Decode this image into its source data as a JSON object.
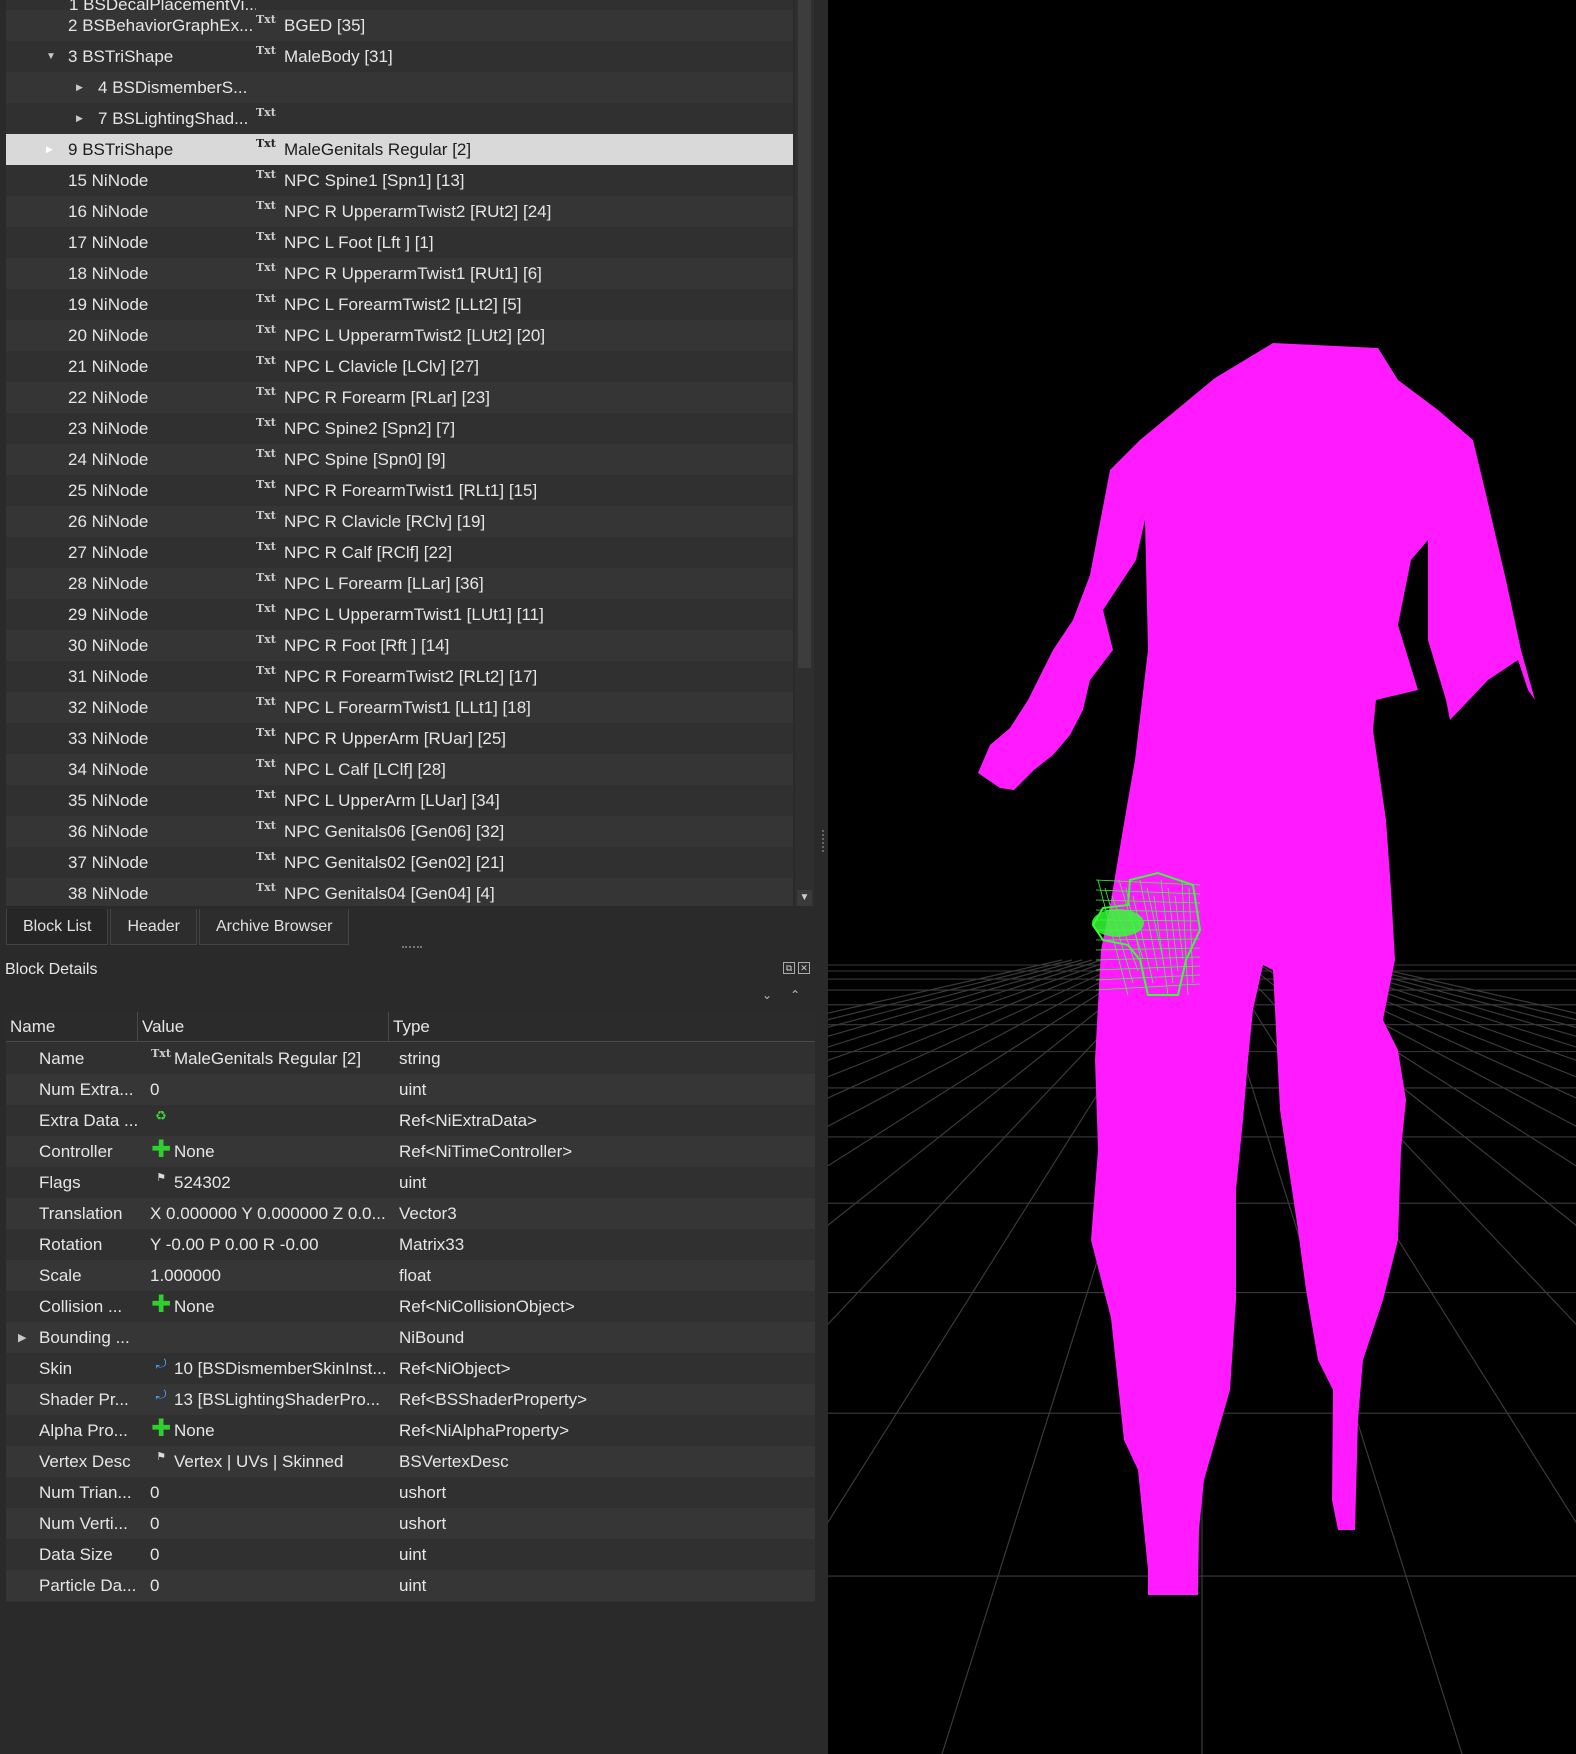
{
  "tree": {
    "partial_top": "1 BSDecalPlacementVi...",
    "rows": [
      {
        "num": "2",
        "type": "BSBehaviorGraphEx...",
        "value": "BGED [35]",
        "icon": true,
        "indent": 0,
        "arrow": ""
      },
      {
        "num": "3",
        "type": "BSTriShape",
        "value": "MaleBody [31]",
        "icon": true,
        "indent": 0,
        "arrow": "down"
      },
      {
        "num": "4",
        "type": "BSDismemberS...",
        "value": "",
        "icon": false,
        "indent": 1,
        "arrow": "right"
      },
      {
        "num": "7",
        "type": "BSLightingShad...",
        "value": "",
        "icon": true,
        "indent": 1,
        "arrow": "right"
      },
      {
        "num": "9",
        "type": "BSTriShape",
        "value": "MaleGenitals Regular [2]",
        "icon": true,
        "indent": 0,
        "arrow": "right",
        "selected": true
      },
      {
        "num": "15",
        "type": "NiNode",
        "value": "NPC Spine1 [Spn1] [13]",
        "icon": true,
        "indent": 0,
        "arrow": ""
      },
      {
        "num": "16",
        "type": "NiNode",
        "value": "NPC R UpperarmTwist2 [RUt2] [24]",
        "icon": true,
        "indent": 0,
        "arrow": ""
      },
      {
        "num": "17",
        "type": "NiNode",
        "value": "NPC L Foot [Lft ] [1]",
        "icon": true,
        "indent": 0,
        "arrow": ""
      },
      {
        "num": "18",
        "type": "NiNode",
        "value": "NPC R UpperarmTwist1 [RUt1] [6]",
        "icon": true,
        "indent": 0,
        "arrow": ""
      },
      {
        "num": "19",
        "type": "NiNode",
        "value": "NPC L ForearmTwist2 [LLt2] [5]",
        "icon": true,
        "indent": 0,
        "arrow": ""
      },
      {
        "num": "20",
        "type": "NiNode",
        "value": "NPC L UpperarmTwist2 [LUt2] [20]",
        "icon": true,
        "indent": 0,
        "arrow": ""
      },
      {
        "num": "21",
        "type": "NiNode",
        "value": "NPC L Clavicle [LClv] [27]",
        "icon": true,
        "indent": 0,
        "arrow": ""
      },
      {
        "num": "22",
        "type": "NiNode",
        "value": "NPC R Forearm [RLar] [23]",
        "icon": true,
        "indent": 0,
        "arrow": ""
      },
      {
        "num": "23",
        "type": "NiNode",
        "value": "NPC Spine2 [Spn2] [7]",
        "icon": true,
        "indent": 0,
        "arrow": ""
      },
      {
        "num": "24",
        "type": "NiNode",
        "value": "NPC Spine [Spn0] [9]",
        "icon": true,
        "indent": 0,
        "arrow": ""
      },
      {
        "num": "25",
        "type": "NiNode",
        "value": "NPC R ForearmTwist1 [RLt1] [15]",
        "icon": true,
        "indent": 0,
        "arrow": ""
      },
      {
        "num": "26",
        "type": "NiNode",
        "value": "NPC R Clavicle [RClv] [19]",
        "icon": true,
        "indent": 0,
        "arrow": ""
      },
      {
        "num": "27",
        "type": "NiNode",
        "value": "NPC R Calf [RClf] [22]",
        "icon": true,
        "indent": 0,
        "arrow": ""
      },
      {
        "num": "28",
        "type": "NiNode",
        "value": "NPC L Forearm [LLar] [36]",
        "icon": true,
        "indent": 0,
        "arrow": ""
      },
      {
        "num": "29",
        "type": "NiNode",
        "value": "NPC L UpperarmTwist1 [LUt1] [11]",
        "icon": true,
        "indent": 0,
        "arrow": ""
      },
      {
        "num": "30",
        "type": "NiNode",
        "value": "NPC R Foot [Rft ] [14]",
        "icon": true,
        "indent": 0,
        "arrow": ""
      },
      {
        "num": "31",
        "type": "NiNode",
        "value": "NPC R ForearmTwist2 [RLt2] [17]",
        "icon": true,
        "indent": 0,
        "arrow": ""
      },
      {
        "num": "32",
        "type": "NiNode",
        "value": "NPC L ForearmTwist1 [LLt1] [18]",
        "icon": true,
        "indent": 0,
        "arrow": ""
      },
      {
        "num": "33",
        "type": "NiNode",
        "value": "NPC R UpperArm [RUar] [25]",
        "icon": true,
        "indent": 0,
        "arrow": ""
      },
      {
        "num": "34",
        "type": "NiNode",
        "value": "NPC L Calf [LClf] [28]",
        "icon": true,
        "indent": 0,
        "arrow": ""
      },
      {
        "num": "35",
        "type": "NiNode",
        "value": "NPC L UpperArm [LUar] [34]",
        "icon": true,
        "indent": 0,
        "arrow": ""
      },
      {
        "num": "36",
        "type": "NiNode",
        "value": "NPC Genitals06 [Gen06] [32]",
        "icon": true,
        "indent": 0,
        "arrow": ""
      },
      {
        "num": "37",
        "type": "NiNode",
        "value": "NPC Genitals02 [Gen02] [21]",
        "icon": true,
        "indent": 0,
        "arrow": ""
      },
      {
        "num": "38",
        "type": "NiNode",
        "value": "NPC Genitals04 [Gen04] [4]",
        "icon": true,
        "indent": 0,
        "arrow": ""
      }
    ]
  },
  "tabs": [
    {
      "label": "Block List",
      "active": true
    },
    {
      "label": "Header",
      "active": false
    },
    {
      "label": "Archive Browser",
      "active": false
    }
  ],
  "block_details": {
    "title": "Block Details",
    "columns": {
      "name": "Name",
      "value": "Value",
      "type": "Type"
    },
    "rows": [
      {
        "name": "Name",
        "icon": "txt",
        "value": "MaleGenitals Regular [2]",
        "type": "string"
      },
      {
        "name": "Num Extra...",
        "icon": "",
        "value": "0",
        "type": "uint"
      },
      {
        "name": "Extra Data ...",
        "icon": "refresh",
        "value": "",
        "type": "Ref<NiExtraData>"
      },
      {
        "name": "Controller",
        "icon": "plus",
        "value": "None",
        "type": "Ref<NiTimeController>"
      },
      {
        "name": "Flags",
        "icon": "flag",
        "value": "524302",
        "type": "uint"
      },
      {
        "name": "Translation",
        "icon": "",
        "value": "X 0.000000 Y 0.000000 Z 0.0...",
        "type": "Vector3"
      },
      {
        "name": "Rotation",
        "icon": "",
        "value": "Y -0.00 P 0.00 R -0.00",
        "type": "Matrix33"
      },
      {
        "name": "Scale",
        "icon": "",
        "value": "1.000000",
        "type": "float"
      },
      {
        "name": "Collision ...",
        "icon": "plus",
        "value": "None",
        "type": "Ref<NiCollisionObject>"
      },
      {
        "name": "Bounding ...",
        "icon": "",
        "value": "",
        "type": "NiBound",
        "arrow": true
      },
      {
        "name": "Skin",
        "icon": "link",
        "value": "10 [BSDismemberSkinInst...",
        "type": "Ref<NiObject>"
      },
      {
        "name": "Shader Pr...",
        "icon": "link",
        "value": "13 [BSLightingShaderPro...",
        "type": "Ref<BSShaderProperty>"
      },
      {
        "name": "Alpha Pro...",
        "icon": "plus",
        "value": "None",
        "type": "Ref<NiAlphaProperty>"
      },
      {
        "name": "Vertex Desc",
        "icon": "flag",
        "value": "Vertex | UVs | Skinned",
        "type": "BSVertexDesc"
      },
      {
        "name": "Num Trian...",
        "icon": "",
        "value": "0",
        "type": "ushort"
      },
      {
        "name": "Num Verti...",
        "icon": "",
        "value": "0",
        "type": "ushort"
      },
      {
        "name": "Data Size",
        "icon": "",
        "value": "0",
        "type": "uint"
      },
      {
        "name": "Particle Da...",
        "icon": "",
        "value": "0",
        "type": "uint"
      }
    ]
  },
  "viewport": {
    "model_color": "#ff1aff",
    "wireframe_color": "#33ff33",
    "grid_color": "#3a3a3a"
  }
}
